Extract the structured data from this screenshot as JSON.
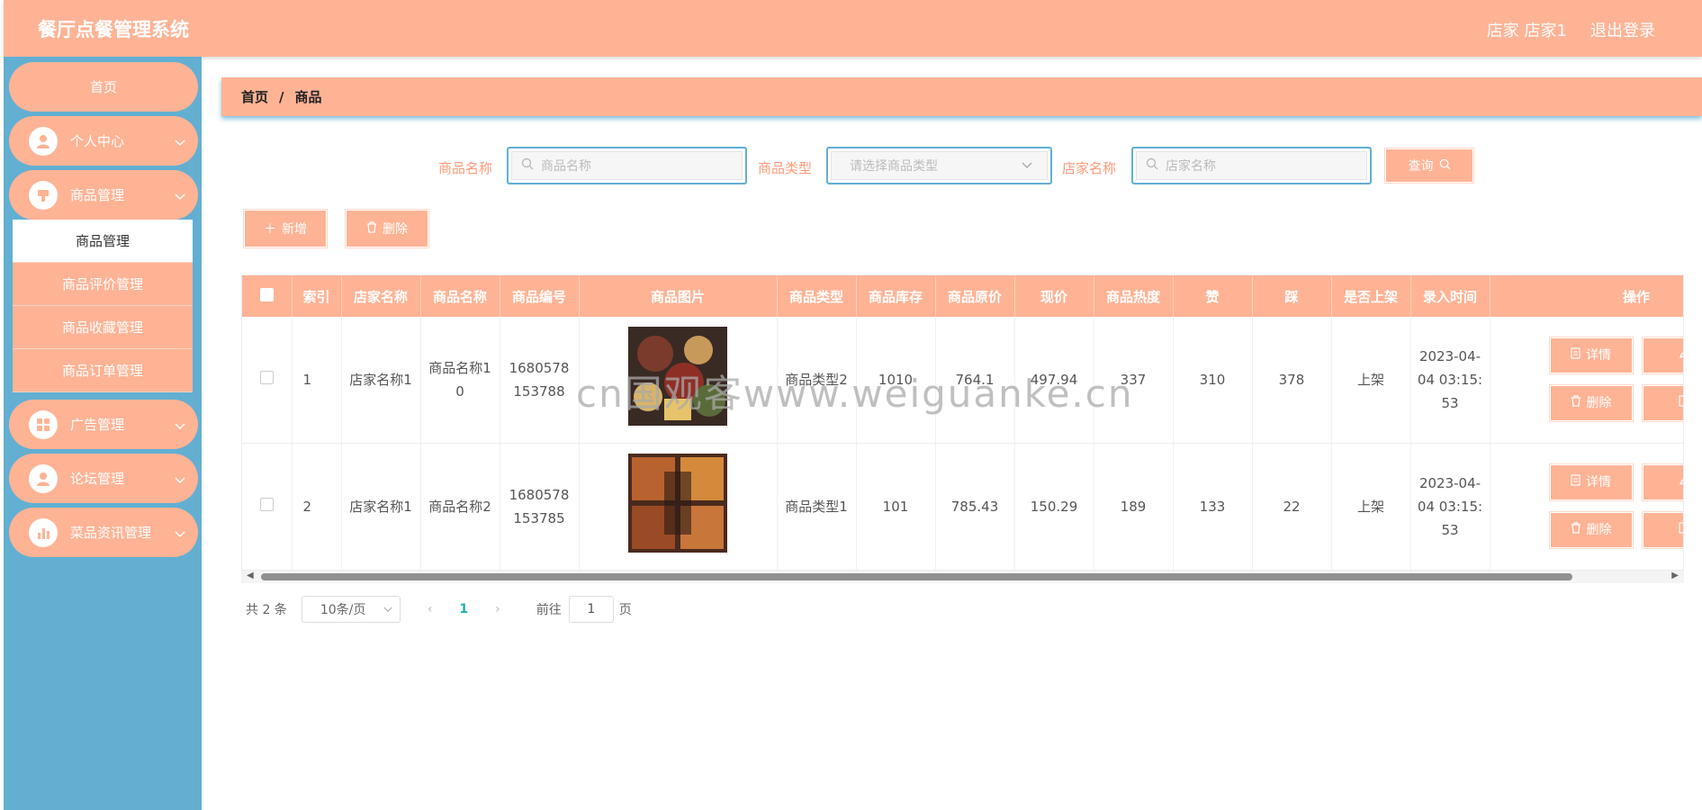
{
  "header": {
    "title": "餐厅点餐管理系统",
    "user_label": "店家 店家1",
    "logout": "退出登录"
  },
  "sidebar": {
    "home": "首页",
    "items": [
      {
        "label": "个人中心",
        "icon": "user-icon"
      },
      {
        "label": "商品管理",
        "icon": "goods-icon"
      },
      {
        "label": "广告管理",
        "icon": "grid-icon"
      },
      {
        "label": "论坛管理",
        "icon": "user-icon"
      },
      {
        "label": "菜品资讯管理",
        "icon": "chart-icon"
      }
    ],
    "submenu": [
      "商品管理",
      "商品评价管理",
      "商品收藏管理",
      "商品订单管理"
    ]
  },
  "breadcrumb": {
    "home": "首页",
    "sep": "/",
    "current": "商品"
  },
  "search": {
    "name_label": "商品名称",
    "name_placeholder": "商品名称",
    "type_label": "商品类型",
    "type_placeholder": "请选择商品类型",
    "shop_label": "店家名称",
    "shop_placeholder": "店家名称",
    "query_btn": "查询"
  },
  "actions": {
    "add": "新增",
    "delete": "删除"
  },
  "table": {
    "columns": [
      "索引",
      "店家名称",
      "商品名称",
      "商品编号",
      "商品图片",
      "商品类型",
      "商品库存",
      "商品原价",
      "现价",
      "商品热度",
      "赞",
      "踩",
      "是否上架",
      "录入时间",
      "操作"
    ],
    "rows": [
      {
        "idx": "1",
        "shop": "店家名称1",
        "name": "商品名称10",
        "code": "1680578153788",
        "type": "商品类型2",
        "stock": "1010",
        "orig": "764.1",
        "price": "497.94",
        "heat": "337",
        "up": "310",
        "down": "378",
        "status": "上架",
        "time": "2023-04-04 03:15:53"
      },
      {
        "idx": "2",
        "shop": "店家名称1",
        "name": "商品名称2",
        "code": "1680578153785",
        "type": "商品类型1",
        "stock": "101",
        "orig": "785.43",
        "price": "150.29",
        "heat": "189",
        "up": "133",
        "down": "22",
        "status": "上架",
        "time": "2023-04-04 03:15:53"
      }
    ],
    "row_actions": {
      "detail": "详情",
      "delete": "删除"
    }
  },
  "pagination": {
    "total": "共 2 条",
    "page_size": "10条/页",
    "current": "1",
    "goto": "前往",
    "goto_value": "1",
    "unit": "页"
  },
  "watermark": "cn国观客www.weiguanke.cn",
  "colors": {
    "accent": "#ffb395",
    "sidebar": "#62afd2",
    "page_active": "#20b2aa"
  }
}
